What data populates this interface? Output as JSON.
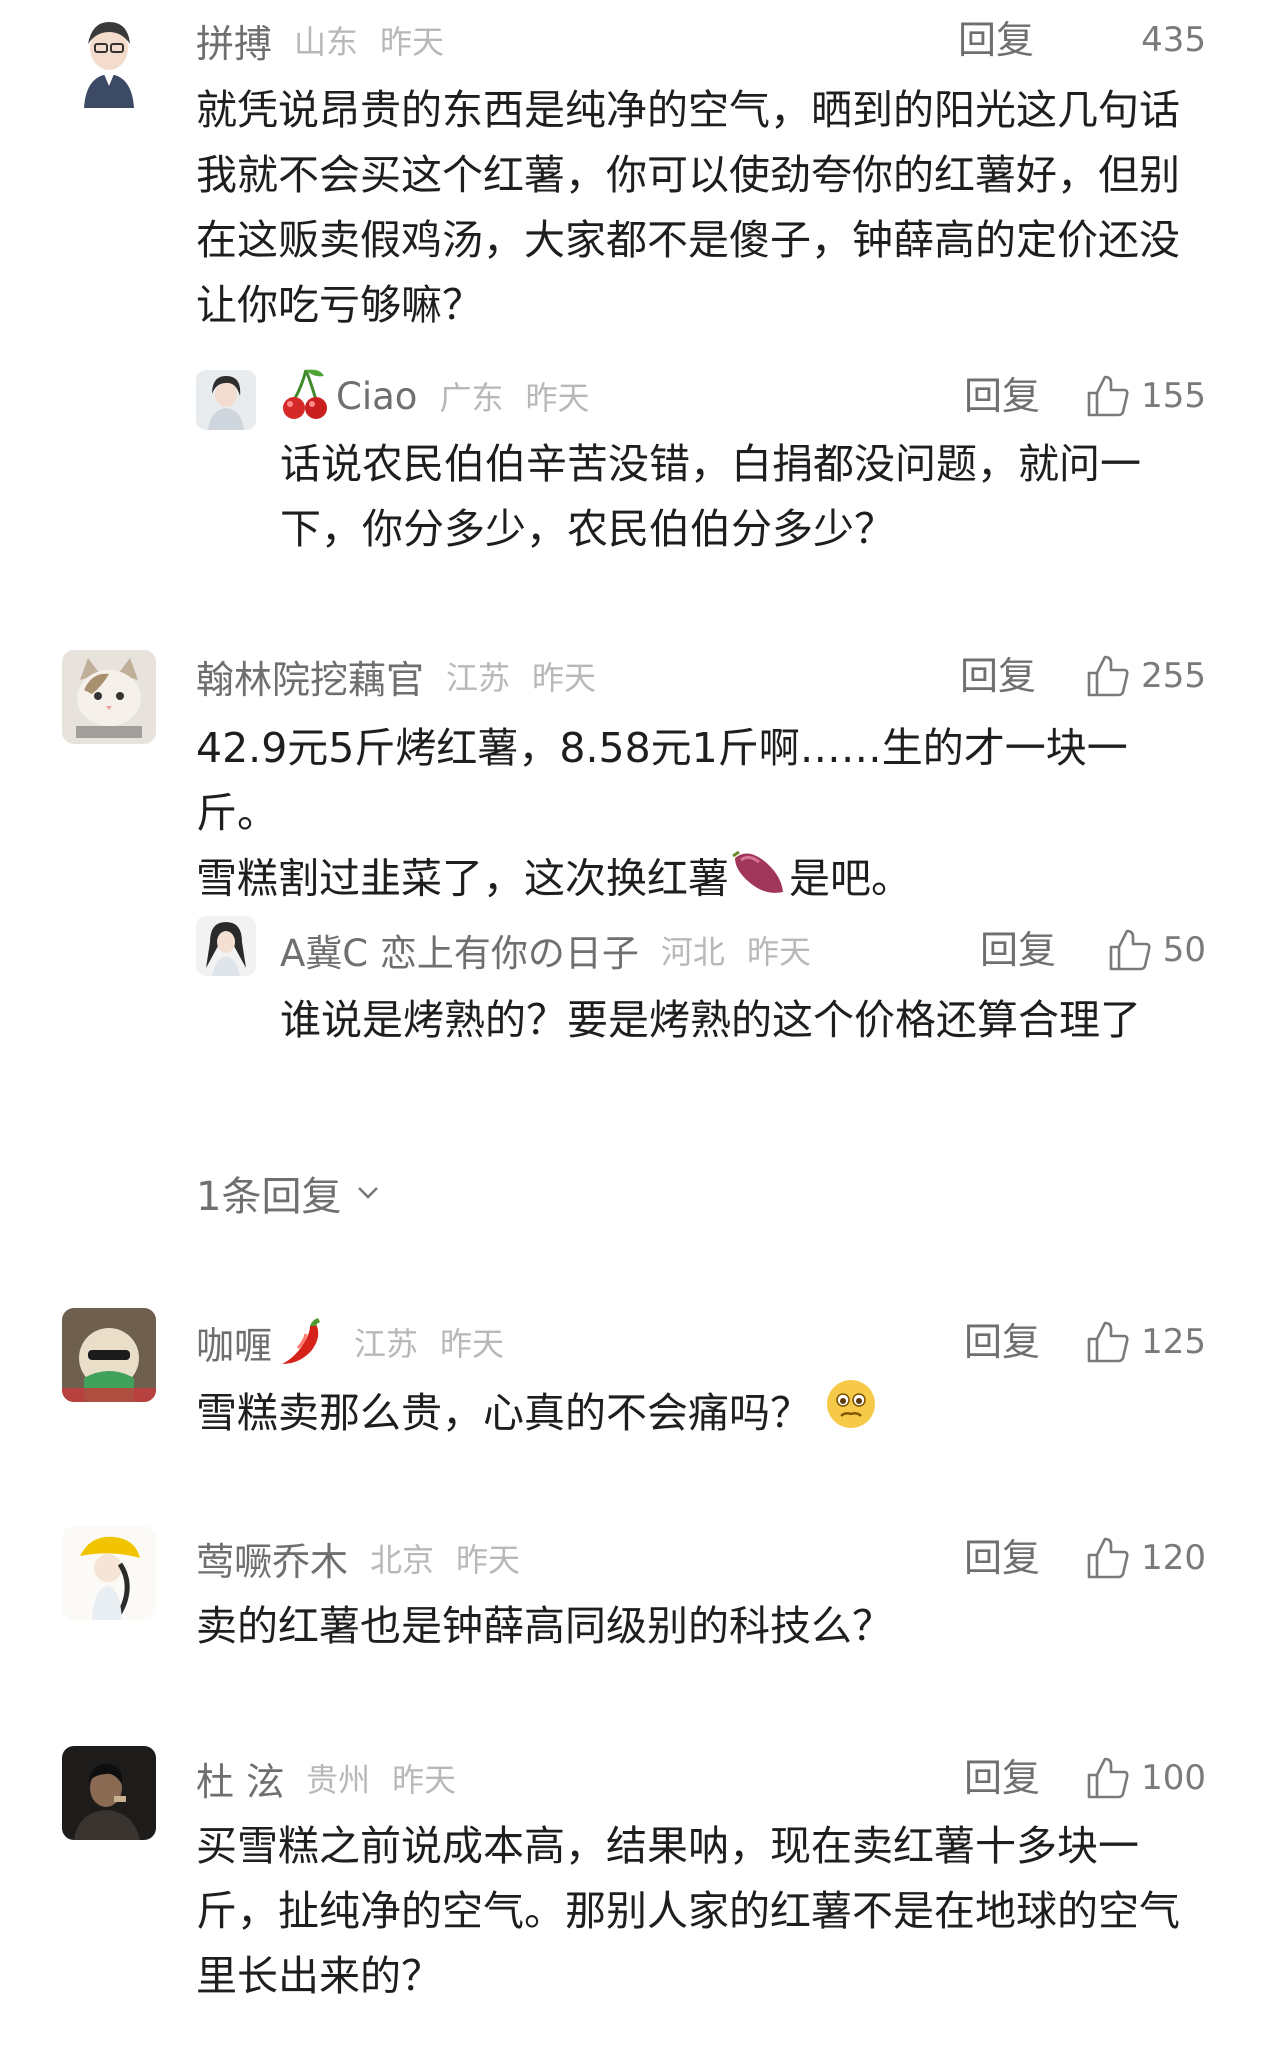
{
  "comments": [
    {
      "user": "拼搏",
      "location": "山东",
      "time": "昨天",
      "reply_label": "回复",
      "likes": "435",
      "text": "就凭说昂贵的东西是纯净的空气，晒到的阳光这几句话我就不会买这个红薯，你可以使劲夸你的红薯好，但别在这贩卖假鸡汤，大家都不是傻子，钟薛高的定价还没让你吃亏够嘛？",
      "reply": {
        "user_prefix_emoji": "cherry-icon",
        "user": "Ciao",
        "location": "广东",
        "time": "昨天",
        "reply_label": "回复",
        "likes": "155",
        "text": "话说农民伯伯辛苦没错，白捐都没问题，就问一下，你分多少，农民伯伯分多少？"
      }
    },
    {
      "user": "翰林院挖藕官",
      "location": "江苏",
      "time": "昨天",
      "reply_label": "回复",
      "likes": "255",
      "text_line1": "42.9元5斤烤红薯，8.58元1斤啊……生的才一块一斤。",
      "text_line2_a": "雪糕割过韭菜了，这次换红薯",
      "text_line2_emoji": "sweet-potato-icon",
      "text_line2_b": "是吧。",
      "reply": {
        "user": "A冀C 恋上有你の日子",
        "location": "河北",
        "time": "昨天",
        "reply_label": "回复",
        "likes": "50",
        "text": "谁说是烤熟的？要是烤熟的这个价格还算合理了"
      },
      "more_replies": "1条回复"
    },
    {
      "user": "咖喱",
      "user_suffix_emoji": "chili-pepper-icon",
      "location": "江苏",
      "time": "昨天",
      "reply_label": "回复",
      "likes": "125",
      "text": "雪糕卖那么贵，心真的不会痛吗？",
      "text_emoji": "worried-face-icon"
    },
    {
      "user": "莺噘乔木",
      "location": "北京",
      "time": "昨天",
      "reply_label": "回复",
      "likes": "120",
      "text": "卖的红薯也是钟薛高同级别的科技么？"
    },
    {
      "user": "杜 泫",
      "location": "贵州",
      "time": "昨天",
      "reply_label": "回复",
      "likes": "100",
      "text": "买雪糕之前说成本高，结果呐，现在卖红薯十多块一斤，扯纯净的空气。那别人家的红薯不是在地球的空气里长出来的？"
    }
  ]
}
